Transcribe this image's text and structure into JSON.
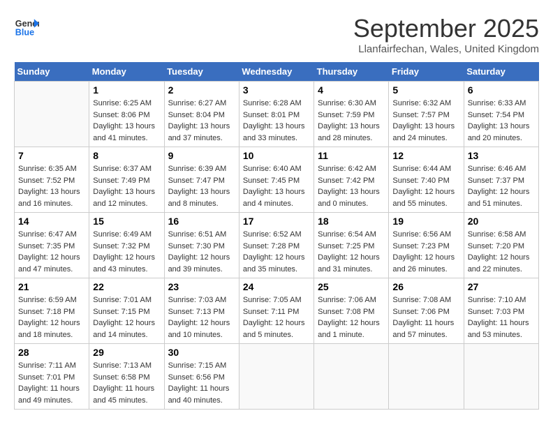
{
  "header": {
    "logo_line1": "General",
    "logo_line2": "Blue",
    "month": "September 2025",
    "location": "Llanfairfechan, Wales, United Kingdom"
  },
  "weekdays": [
    "Sunday",
    "Monday",
    "Tuesday",
    "Wednesday",
    "Thursday",
    "Friday",
    "Saturday"
  ],
  "weeks": [
    [
      {
        "day": "",
        "info": ""
      },
      {
        "day": "1",
        "info": "Sunrise: 6:25 AM\nSunset: 8:06 PM\nDaylight: 13 hours\nand 41 minutes."
      },
      {
        "day": "2",
        "info": "Sunrise: 6:27 AM\nSunset: 8:04 PM\nDaylight: 13 hours\nand 37 minutes."
      },
      {
        "day": "3",
        "info": "Sunrise: 6:28 AM\nSunset: 8:01 PM\nDaylight: 13 hours\nand 33 minutes."
      },
      {
        "day": "4",
        "info": "Sunrise: 6:30 AM\nSunset: 7:59 PM\nDaylight: 13 hours\nand 28 minutes."
      },
      {
        "day": "5",
        "info": "Sunrise: 6:32 AM\nSunset: 7:57 PM\nDaylight: 13 hours\nand 24 minutes."
      },
      {
        "day": "6",
        "info": "Sunrise: 6:33 AM\nSunset: 7:54 PM\nDaylight: 13 hours\nand 20 minutes."
      }
    ],
    [
      {
        "day": "7",
        "info": "Sunrise: 6:35 AM\nSunset: 7:52 PM\nDaylight: 13 hours\nand 16 minutes."
      },
      {
        "day": "8",
        "info": "Sunrise: 6:37 AM\nSunset: 7:49 PM\nDaylight: 13 hours\nand 12 minutes."
      },
      {
        "day": "9",
        "info": "Sunrise: 6:39 AM\nSunset: 7:47 PM\nDaylight: 13 hours\nand 8 minutes."
      },
      {
        "day": "10",
        "info": "Sunrise: 6:40 AM\nSunset: 7:45 PM\nDaylight: 13 hours\nand 4 minutes."
      },
      {
        "day": "11",
        "info": "Sunrise: 6:42 AM\nSunset: 7:42 PM\nDaylight: 13 hours\nand 0 minutes."
      },
      {
        "day": "12",
        "info": "Sunrise: 6:44 AM\nSunset: 7:40 PM\nDaylight: 12 hours\nand 55 minutes."
      },
      {
        "day": "13",
        "info": "Sunrise: 6:46 AM\nSunset: 7:37 PM\nDaylight: 12 hours\nand 51 minutes."
      }
    ],
    [
      {
        "day": "14",
        "info": "Sunrise: 6:47 AM\nSunset: 7:35 PM\nDaylight: 12 hours\nand 47 minutes."
      },
      {
        "day": "15",
        "info": "Sunrise: 6:49 AM\nSunset: 7:32 PM\nDaylight: 12 hours\nand 43 minutes."
      },
      {
        "day": "16",
        "info": "Sunrise: 6:51 AM\nSunset: 7:30 PM\nDaylight: 12 hours\nand 39 minutes."
      },
      {
        "day": "17",
        "info": "Sunrise: 6:52 AM\nSunset: 7:28 PM\nDaylight: 12 hours\nand 35 minutes."
      },
      {
        "day": "18",
        "info": "Sunrise: 6:54 AM\nSunset: 7:25 PM\nDaylight: 12 hours\nand 31 minutes."
      },
      {
        "day": "19",
        "info": "Sunrise: 6:56 AM\nSunset: 7:23 PM\nDaylight: 12 hours\nand 26 minutes."
      },
      {
        "day": "20",
        "info": "Sunrise: 6:58 AM\nSunset: 7:20 PM\nDaylight: 12 hours\nand 22 minutes."
      }
    ],
    [
      {
        "day": "21",
        "info": "Sunrise: 6:59 AM\nSunset: 7:18 PM\nDaylight: 12 hours\nand 18 minutes."
      },
      {
        "day": "22",
        "info": "Sunrise: 7:01 AM\nSunset: 7:15 PM\nDaylight: 12 hours\nand 14 minutes."
      },
      {
        "day": "23",
        "info": "Sunrise: 7:03 AM\nSunset: 7:13 PM\nDaylight: 12 hours\nand 10 minutes."
      },
      {
        "day": "24",
        "info": "Sunrise: 7:05 AM\nSunset: 7:11 PM\nDaylight: 12 hours\nand 5 minutes."
      },
      {
        "day": "25",
        "info": "Sunrise: 7:06 AM\nSunset: 7:08 PM\nDaylight: 12 hours\nand 1 minute."
      },
      {
        "day": "26",
        "info": "Sunrise: 7:08 AM\nSunset: 7:06 PM\nDaylight: 11 hours\nand 57 minutes."
      },
      {
        "day": "27",
        "info": "Sunrise: 7:10 AM\nSunset: 7:03 PM\nDaylight: 11 hours\nand 53 minutes."
      }
    ],
    [
      {
        "day": "28",
        "info": "Sunrise: 7:11 AM\nSunset: 7:01 PM\nDaylight: 11 hours\nand 49 minutes."
      },
      {
        "day": "29",
        "info": "Sunrise: 7:13 AM\nSunset: 6:58 PM\nDaylight: 11 hours\nand 45 minutes."
      },
      {
        "day": "30",
        "info": "Sunrise: 7:15 AM\nSunset: 6:56 PM\nDaylight: 11 hours\nand 40 minutes."
      },
      {
        "day": "",
        "info": ""
      },
      {
        "day": "",
        "info": ""
      },
      {
        "day": "",
        "info": ""
      },
      {
        "day": "",
        "info": ""
      }
    ]
  ]
}
